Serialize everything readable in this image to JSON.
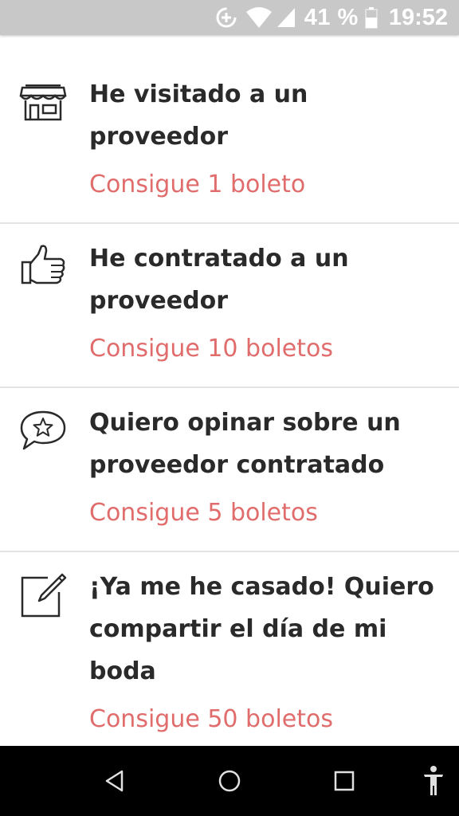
{
  "status_bar": {
    "battery_percent": "41 %",
    "time": "19:52",
    "icons": [
      "data-saver-icon",
      "wifi-icon",
      "signal-icon",
      "battery-icon"
    ]
  },
  "items": [
    {
      "icon": "store-icon",
      "title": "He visitado a un proveedor",
      "reward": "Consigue 1 boleto"
    },
    {
      "icon": "thumbs-up-icon",
      "title": "He contratado a un proveedor",
      "reward": "Consigue 10 boletos"
    },
    {
      "icon": "star-speech-bubble-icon",
      "title": "Quiero opinar sobre un proveedor contratado",
      "reward": "Consigue 5 boletos"
    },
    {
      "icon": "edit-pencil-icon",
      "title": "¡Ya me he casado! Quiero compartir el día de mi boda",
      "reward": "Consigue 50 boletos"
    }
  ],
  "nav_bar": {
    "icons": [
      "back-icon",
      "home-icon",
      "recents-icon",
      "accessibility-icon"
    ]
  },
  "colors": {
    "accent": "#e06c6c",
    "title": "#2a2a2a",
    "divider": "#e4e4e4",
    "status_bar": "#c8c8c8"
  }
}
